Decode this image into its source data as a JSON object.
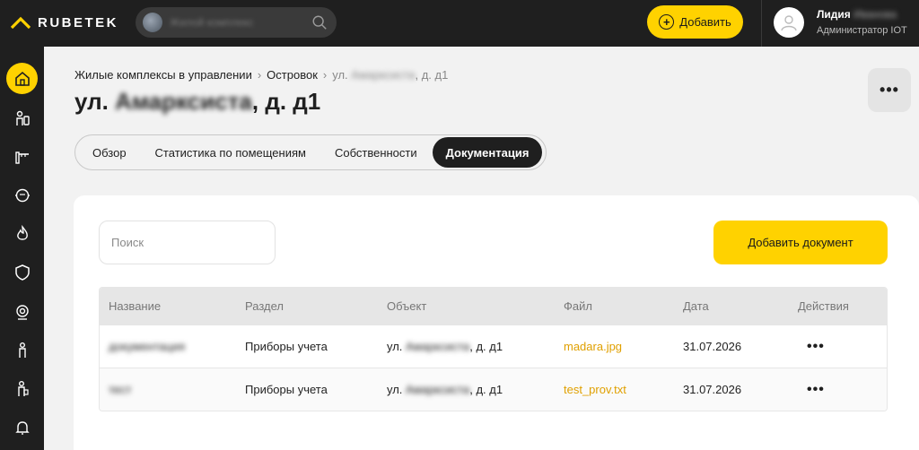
{
  "brand": {
    "name": "RUBETEK",
    "color": "#ffd200"
  },
  "header": {
    "location_search_text": "Жилой комплекс",
    "add_button_label": "Добавить",
    "user": {
      "first_name": "Лидия",
      "last_name": "Иванова",
      "role": "Администратор IOT"
    }
  },
  "sidebar": {
    "items": [
      {
        "icon": "home-icon",
        "active": true
      },
      {
        "icon": "residents-icon"
      },
      {
        "icon": "barrier-icon"
      },
      {
        "icon": "meter-icon"
      },
      {
        "icon": "fire-icon"
      },
      {
        "icon": "shield-icon"
      },
      {
        "icon": "camera-icon"
      },
      {
        "icon": "person-icon"
      },
      {
        "icon": "person-badge-icon"
      },
      {
        "icon": "bell-icon"
      }
    ]
  },
  "breadcrumb": {
    "item1": "Жилые комплексы в управлении",
    "item2": "Островок",
    "item3_prefix": "ул.",
    "item3_hidden": "Амарксиста",
    "item3_suffix": ", д. д1"
  },
  "page": {
    "title_prefix": "ул.",
    "title_hidden": "Амарксиста",
    "title_suffix": ", д. д1",
    "more_label": "•••"
  },
  "tabs": [
    {
      "label": "Обзор",
      "active": false
    },
    {
      "label": "Статистика по помещениям",
      "active": false
    },
    {
      "label": "Собственности",
      "active": false
    },
    {
      "label": "Документация",
      "active": true
    }
  ],
  "documents": {
    "search_placeholder": "Поиск",
    "add_button_label": "Добавить документ",
    "columns": [
      "Название",
      "Раздел",
      "Объект",
      "Файл",
      "Дата",
      "Действия"
    ],
    "rows": [
      {
        "name": "документация",
        "section": "Приборы учета",
        "object_prefix": "ул.",
        "object_hidden": "Амарксиста",
        "object_suffix": ", д. д1",
        "file": "madara.jpg",
        "date": "31.07.2026",
        "actions": "•••"
      },
      {
        "name": "тест",
        "section": "Приборы учета",
        "object_prefix": "ул.",
        "object_hidden": "Амарксиста",
        "object_suffix": ", д. д1",
        "file": "test_prov.txt",
        "date": "31.07.2026",
        "actions": "•••"
      }
    ]
  }
}
